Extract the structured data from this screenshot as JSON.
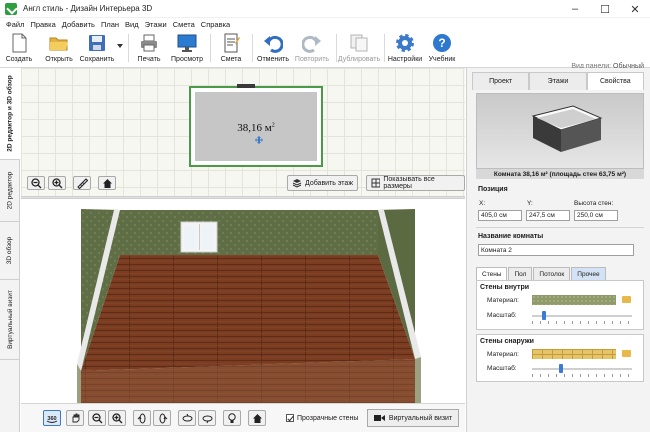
{
  "window": {
    "title": "Англ стиль - Дизайн Интерьера 3D"
  },
  "menu": [
    "Файл",
    "Правка",
    "Добавить",
    "План",
    "Вид",
    "Этажи",
    "Смета",
    "Справка"
  ],
  "toolbar": {
    "create": "Создать",
    "open": "Открыть",
    "save": "Сохранить",
    "print": "Печать",
    "preview": "Просмотр",
    "estimate": "Смета",
    "undo": "Отменить",
    "redo": "Повторить",
    "duplicate": "Дублировать",
    "settings": "Настройки",
    "tutorial": "Учебник"
  },
  "view_panel": {
    "label": "Вид панели:",
    "value": "Обычный"
  },
  "side_tabs": [
    "2D редактор и 3D обзор",
    "2D редактор",
    "3D обзор",
    "Виртуальный визит"
  ],
  "plan": {
    "room_label": "38,16 м",
    "room_label_sup": "2",
    "add_floor": "Добавить этаж",
    "show_sizes": "Показывать все размеры"
  },
  "view3d": {
    "transparent_walls_label": "Прозрачные стены",
    "transparent_walls_checked": true,
    "virtual_visit": "Виртуальный визит"
  },
  "props": {
    "tabs": [
      "Проект",
      "Этажи",
      "Свойства"
    ],
    "active_tab": "Свойства",
    "caption": "Комната 38,16 м² (площадь стен 63,75 м²)",
    "position": {
      "heading": "Позиция",
      "x_label": "X:",
      "x": "405,0 см",
      "y_label": "Y:",
      "y": "247,5 см",
      "h_label": "Высота стен:",
      "h": "250,0 см"
    },
    "name": {
      "heading": "Название комнаты",
      "value": "Комната 2"
    },
    "subtabs": [
      "Стены",
      "Пол",
      "Потолок",
      "Прочее"
    ],
    "walls_inside": {
      "heading": "Стены внутри",
      "material_label": "Материал:",
      "scale_label": "Масштаб:",
      "scale_pct": 10
    },
    "walls_outside": {
      "heading": "Стены снаружи",
      "material_label": "Материал:",
      "scale_label": "Масштаб:",
      "scale_pct": 27
    }
  },
  "colors": {
    "wall_green": "#6b7a4e",
    "floor_wood": "#7a3d22",
    "accent_blue": "#3b7ac9",
    "plan_wall": "#4a9a46"
  }
}
